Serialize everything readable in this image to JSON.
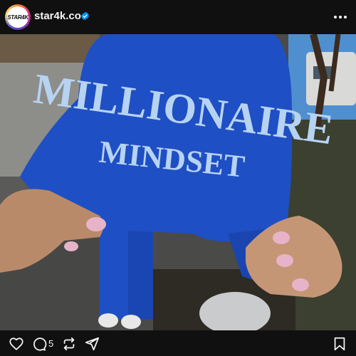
{
  "post": {
    "avatar_text": "STAR4K",
    "username": "star4k.co",
    "verified": true,
    "reply_count": "5"
  },
  "photo": {
    "shirt_text_top": "MILLIONAIRE",
    "shirt_text_bottom": "MINDSET",
    "hoodie_color": "#1f4fc4",
    "lettering_color": "#b7d3f2"
  },
  "icons": {
    "more": "more-horizontal-icon",
    "like": "heart-icon",
    "reply": "comment-icon",
    "repost": "repost-icon",
    "share": "send-icon",
    "save": "bookmark-icon"
  },
  "colors": {
    "background": "#101010",
    "text": "#f3f5f7",
    "verified": "#0095f6"
  }
}
